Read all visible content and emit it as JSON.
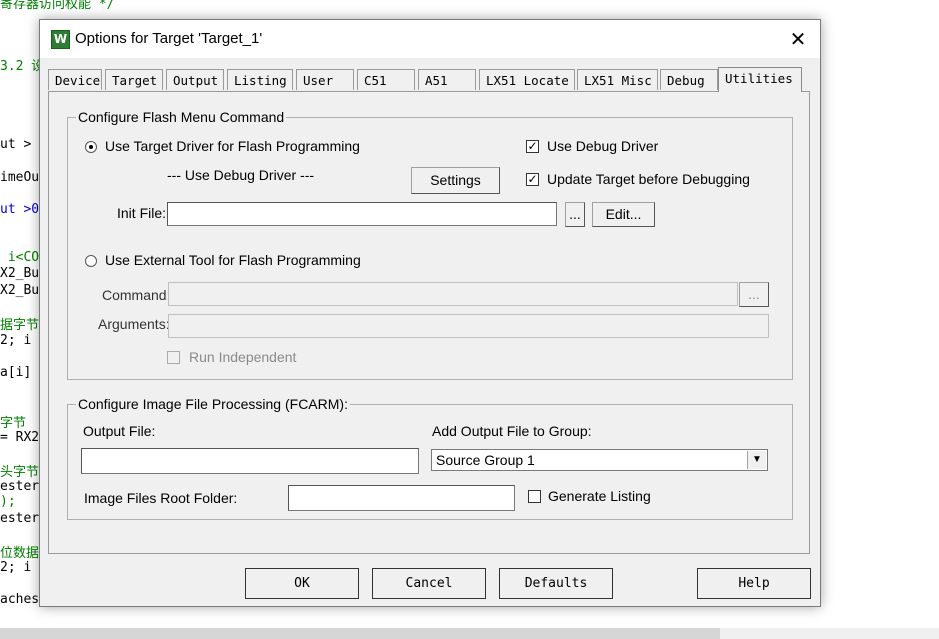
{
  "background_code": {
    "lines": [
      {
        "text": "寄存器访问权能 */",
        "style": "green"
      },
      {
        "text": "3.2 设",
        "style": "green"
      },
      {
        "text": "ut >",
        "style": "black"
      },
      {
        "text": "imeOu",
        "style": "black"
      },
      {
        "text": "ut >0",
        "style": "blue"
      },
      {
        "text": " i<CO",
        "style": "green"
      },
      {
        "text": "X2_Bu",
        "style": "black"
      },
      {
        "text": "X2_Bu",
        "style": "black"
      },
      {
        "text": "据字节",
        "style": "green"
      },
      {
        "text": "2; i",
        "style": "black"
      },
      {
        "text": "a[i] ",
        "style": "black"
      },
      {
        "text": "字节",
        "style": "green"
      },
      {
        "text": "= RX2",
        "style": "black"
      },
      {
        "text": "头字节",
        "style": "green"
      },
      {
        "text": "ester",
        "style": "black"
      },
      {
        "text": ");",
        "style": "green"
      },
      {
        "text": "ester",
        "style": "black"
      },
      {
        "text": "位数据",
        "style": "green"
      },
      {
        "text": "2; i",
        "style": "black"
      },
      {
        "text": "aches",
        "style": "black"
      }
    ]
  },
  "dialog": {
    "title": "Options for Target 'Target_1'",
    "close_glyph": "✕",
    "app_icon_glyph": "W",
    "tabs": [
      "Device",
      "Target",
      "Output",
      "Listing",
      "User",
      "C51",
      "A51",
      "LX51 Locate",
      "LX51 Misc",
      "Debug",
      "Utilities"
    ],
    "active_tab": "Utilities",
    "flash_group": {
      "label": "Configure Flash Menu Command",
      "use_target_driver": "Use Target Driver for Flash Programming",
      "use_debug_driver_dash": "--- Use Debug Driver ---",
      "settings_button": "Settings",
      "use_debug_driver_cb": "Use Debug Driver",
      "update_target_cb": "Update Target before Debugging",
      "init_file_label": "Init File:",
      "init_file_value": "",
      "browse_button": "...",
      "edit_button": "Edit...",
      "use_external_tool": "Use External Tool for Flash Programming",
      "command_label": "Command:",
      "command_value": "",
      "command_browse": "...",
      "arguments_label": "Arguments:",
      "arguments_value": "",
      "run_independent": "Run Independent",
      "check_glyph": "✓"
    },
    "image_group": {
      "label": "Configure Image File Processing (FCARM):",
      "output_file_label": "Output File:",
      "output_file_value": "",
      "add_output_label": "Add Output File  to Group:",
      "group_selected": "Source Group 1",
      "dropdown_arrow": "▼",
      "root_folder_label": "Image Files Root Folder:",
      "root_folder_value": "",
      "generate_listing": "Generate Listing"
    },
    "buttons": {
      "ok": "OK",
      "cancel": "Cancel",
      "defaults": "Defaults",
      "help": "Help"
    }
  }
}
